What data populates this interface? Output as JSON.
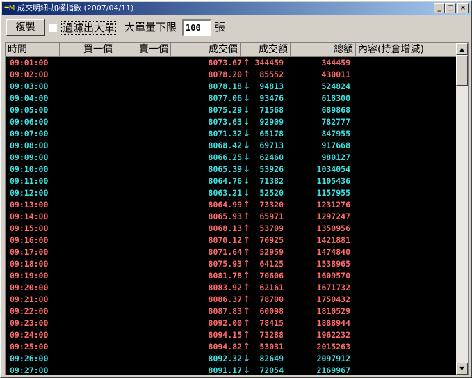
{
  "window": {
    "title": "成交明細-加權指數 (2007/04/11)",
    "app_icon": "━M",
    "minimize": "_",
    "maximize": "□",
    "close": "×"
  },
  "toolbar": {
    "copy_label": "複製",
    "filter_label": "過濾出大單",
    "threshold_prefix": "大單量下限",
    "threshold_value": "100",
    "threshold_unit": "張"
  },
  "colors": {
    "up": "#ff6b6b",
    "down": "#3ee0e0",
    "flat": "#ff6b6b"
  },
  "table": {
    "columns": [
      "時間",
      "買一價",
      "賣一價",
      "成交價",
      "成交額",
      "總額",
      "內容(持倉增減)"
    ],
    "rows": [
      {
        "time": "09:01:00",
        "price": "8073.67",
        "dir": "up",
        "vol": "344459",
        "total": "344459"
      },
      {
        "time": "09:02:00",
        "price": "8078.20",
        "dir": "up",
        "vol": "85552",
        "total": "430011"
      },
      {
        "time": "09:03:00",
        "price": "8078.18",
        "dir": "down",
        "vol": "94813",
        "total": "524824"
      },
      {
        "time": "09:04:00",
        "price": "8077.06",
        "dir": "down",
        "vol": "93476",
        "total": "618300"
      },
      {
        "time": "09:05:00",
        "price": "8075.29",
        "dir": "down",
        "vol": "71568",
        "total": "689868"
      },
      {
        "time": "09:06:00",
        "price": "8073.63",
        "dir": "down",
        "vol": "92909",
        "total": "782777"
      },
      {
        "time": "09:07:00",
        "price": "8071.32",
        "dir": "down",
        "vol": "65178",
        "total": "847955"
      },
      {
        "time": "09:08:00",
        "price": "8068.42",
        "dir": "down",
        "vol": "69713",
        "total": "917668"
      },
      {
        "time": "09:09:00",
        "price": "8066.25",
        "dir": "down",
        "vol": "62460",
        "total": "980127"
      },
      {
        "time": "09:10:00",
        "price": "8065.39",
        "dir": "down",
        "vol": "53926",
        "total": "1034054"
      },
      {
        "time": "09:11:00",
        "price": "8064.76",
        "dir": "down",
        "vol": "71382",
        "total": "1105436"
      },
      {
        "time": "09:12:00",
        "price": "8063.21",
        "dir": "down",
        "vol": "52520",
        "total": "1157955"
      },
      {
        "time": "09:13:00",
        "price": "8064.99",
        "dir": "up",
        "vol": "73320",
        "total": "1231276"
      },
      {
        "time": "09:14:00",
        "price": "8065.93",
        "dir": "up",
        "vol": "65971",
        "total": "1297247"
      },
      {
        "time": "09:15:00",
        "price": "8068.13",
        "dir": "up",
        "vol": "53709",
        "total": "1350956"
      },
      {
        "time": "09:16:00",
        "price": "8070.12",
        "dir": "up",
        "vol": "70925",
        "total": "1421881"
      },
      {
        "time": "09:17:00",
        "price": "8071.64",
        "dir": "up",
        "vol": "52959",
        "total": "1474840"
      },
      {
        "time": "09:18:00",
        "price": "8075.93",
        "dir": "up",
        "vol": "64125",
        "total": "1538965"
      },
      {
        "time": "09:19:00",
        "price": "8081.78",
        "dir": "up",
        "vol": "70606",
        "total": "1609570"
      },
      {
        "time": "09:20:00",
        "price": "8083.92",
        "dir": "up",
        "vol": "62161",
        "total": "1671732"
      },
      {
        "time": "09:21:00",
        "price": "8086.37",
        "dir": "up",
        "vol": "78700",
        "total": "1750432"
      },
      {
        "time": "09:22:00",
        "price": "8087.83",
        "dir": "up",
        "vol": "60098",
        "total": "1810529"
      },
      {
        "time": "09:23:00",
        "price": "8092.00",
        "dir": "up",
        "vol": "78415",
        "total": "1888944"
      },
      {
        "time": "09:24:00",
        "price": "8094.15",
        "dir": "up",
        "vol": "73288",
        "total": "1962232"
      },
      {
        "time": "09:25:00",
        "price": "8094.82",
        "dir": "up",
        "vol": "53031",
        "total": "2015263"
      },
      {
        "time": "09:26:00",
        "price": "8092.32",
        "dir": "down",
        "vol": "82649",
        "total": "2097912"
      },
      {
        "time": "09:27:00",
        "price": "8091.17",
        "dir": "down",
        "vol": "72054",
        "total": "2169967"
      }
    ]
  },
  "icons": {
    "up_arrow": "↑",
    "down_arrow": "↓",
    "scroll_up": "▲",
    "scroll_down": "▼"
  }
}
